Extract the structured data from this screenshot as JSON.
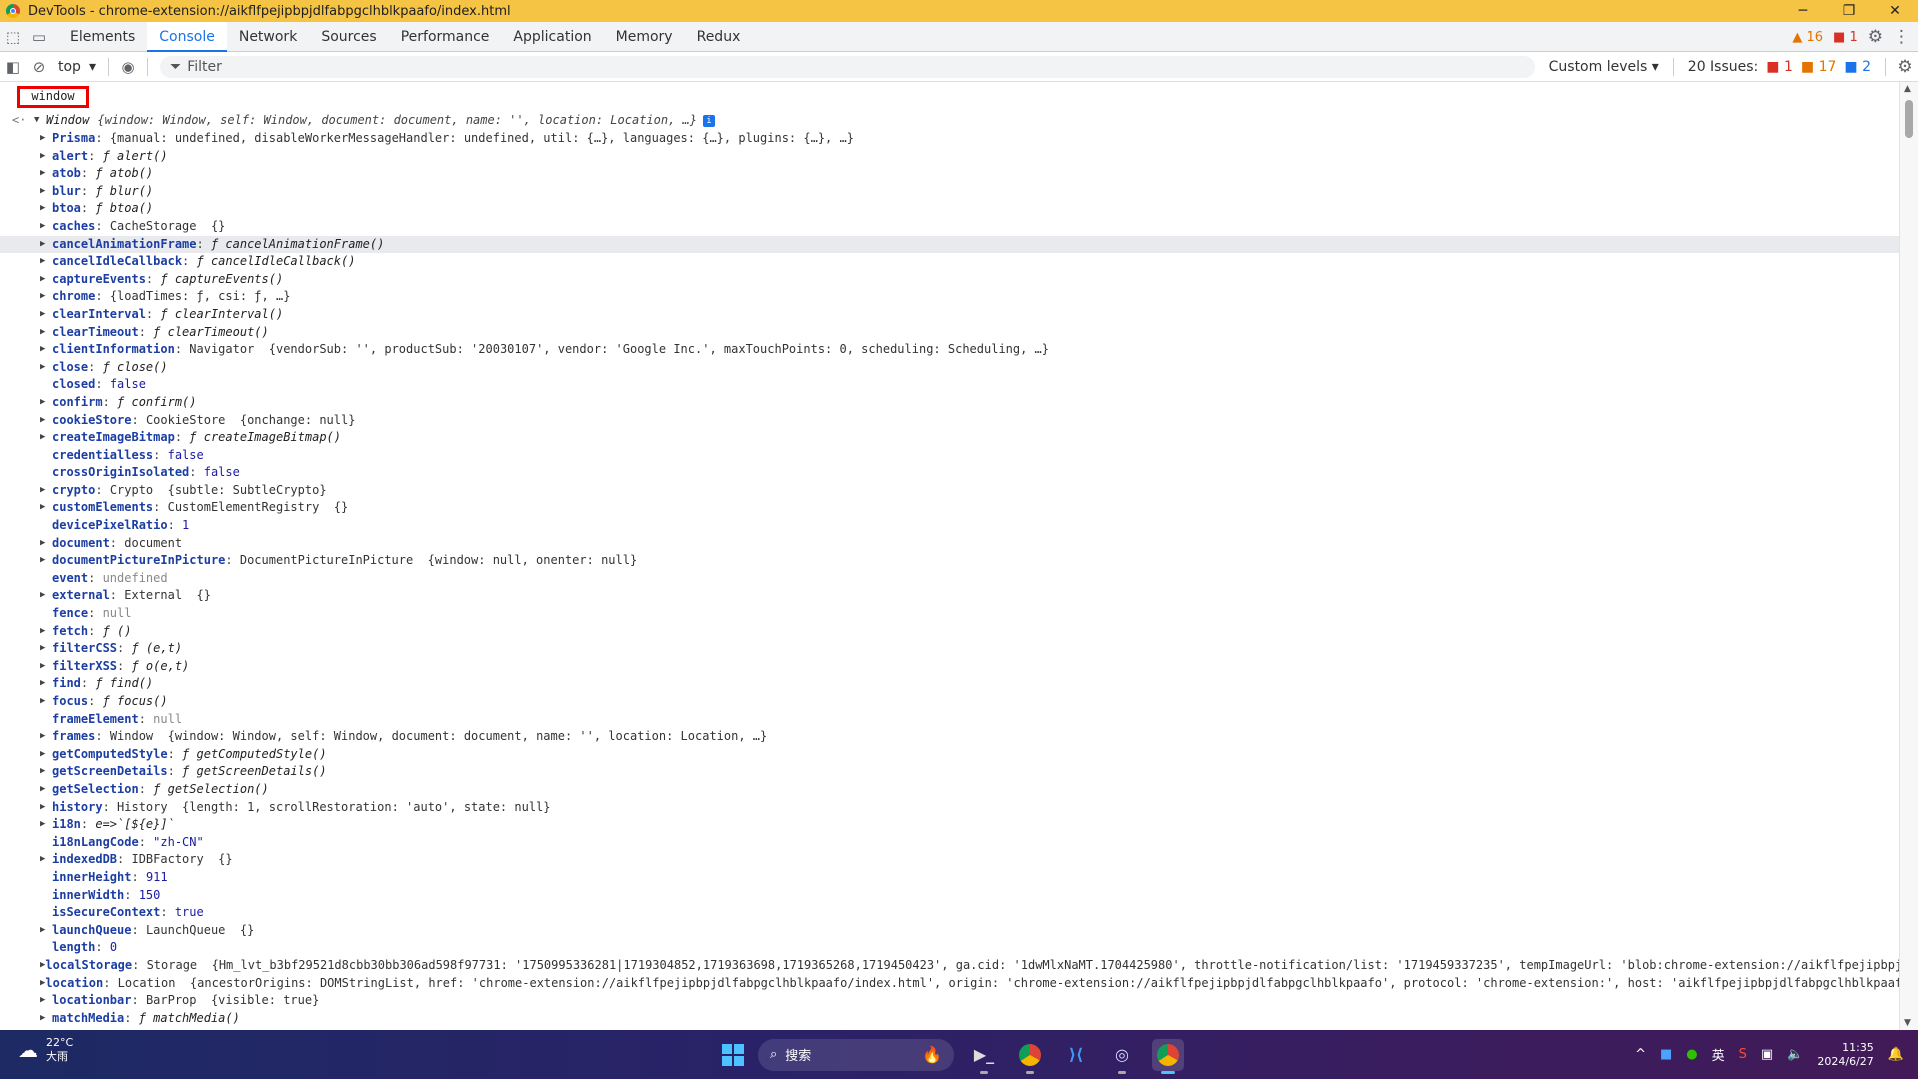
{
  "window": {
    "title": "DevTools - chrome-extension://aikflfpejipbpjdlfabpgclhblkpaafo/index.html",
    "controls": {
      "minimize": "─",
      "restore": "❐",
      "close": "✕"
    }
  },
  "tabs": [
    "Elements",
    "Console",
    "Network",
    "Sources",
    "Performance",
    "Application",
    "Memory",
    "Redux"
  ],
  "active_tab": "Console",
  "tab_status": {
    "warnings": "16",
    "errors": "1"
  },
  "toolbar": {
    "context": "top",
    "filter_placeholder": "Filter",
    "levels": "Custom levels ▾",
    "issues_label": "20 Issues:",
    "issues_errors": "1",
    "issues_warnings": "17",
    "issues_info": "2"
  },
  "console": {
    "command": "window",
    "result": "Window",
    "result_preview": "{window: Window, self: Window, document: document, name: '', location: Location, …}",
    "properties": [
      {
        "key": "Prisma",
        "expand": true,
        "value": "{manual: undefined, disableWorkerMessageHandler: undefined, util: {…}, languages: {…}, plugins: {…}, …}",
        "kind": "obj"
      },
      {
        "key": "alert",
        "expand": true,
        "value": "ƒ alert()",
        "kind": "fn"
      },
      {
        "key": "atob",
        "expand": true,
        "value": "ƒ atob()",
        "kind": "fn"
      },
      {
        "key": "blur",
        "expand": true,
        "value": "ƒ blur()",
        "kind": "fn"
      },
      {
        "key": "btoa",
        "expand": true,
        "value": "ƒ btoa()",
        "kind": "fn"
      },
      {
        "key": "caches",
        "expand": true,
        "value": "CacheStorage  {}",
        "kind": "obj"
      },
      {
        "key": "cancelAnimationFrame",
        "expand": true,
        "value": "ƒ cancelAnimationFrame()",
        "kind": "fn",
        "highlight": true
      },
      {
        "key": "cancelIdleCallback",
        "expand": true,
        "value": "ƒ cancelIdleCallback()",
        "kind": "fn"
      },
      {
        "key": "captureEvents",
        "expand": true,
        "value": "ƒ captureEvents()",
        "kind": "fn"
      },
      {
        "key": "chrome",
        "expand": true,
        "value": "{loadTimes: ƒ, csi: ƒ, …}",
        "kind": "obj"
      },
      {
        "key": "clearInterval",
        "expand": true,
        "value": "ƒ clearInterval()",
        "kind": "fn"
      },
      {
        "key": "clearTimeout",
        "expand": true,
        "value": "ƒ clearTimeout()",
        "kind": "fn"
      },
      {
        "key": "clientInformation",
        "expand": true,
        "value": "Navigator  {vendorSub: '', productSub: '20030107', vendor: 'Google Inc.', maxTouchPoints: 0, scheduling: Scheduling, …}",
        "kind": "obj"
      },
      {
        "key": "close",
        "expand": true,
        "value": "ƒ close()",
        "kind": "fn"
      },
      {
        "key": "closed",
        "expand": false,
        "value": "false",
        "kind": "num"
      },
      {
        "key": "confirm",
        "expand": true,
        "value": "ƒ confirm()",
        "kind": "fn"
      },
      {
        "key": "cookieStore",
        "expand": true,
        "value": "CookieStore  {onchange: null}",
        "kind": "obj"
      },
      {
        "key": "createImageBitmap",
        "expand": true,
        "value": "ƒ createImageBitmap()",
        "kind": "fn"
      },
      {
        "key": "credentialless",
        "expand": false,
        "value": "false",
        "kind": "num"
      },
      {
        "key": "crossOriginIsolated",
        "expand": false,
        "value": "false",
        "kind": "num"
      },
      {
        "key": "crypto",
        "expand": true,
        "value": "Crypto  {subtle: SubtleCrypto}",
        "kind": "obj"
      },
      {
        "key": "customElements",
        "expand": true,
        "value": "CustomElementRegistry  {}",
        "kind": "obj"
      },
      {
        "key": "devicePixelRatio",
        "expand": false,
        "value": "1",
        "kind": "num"
      },
      {
        "key": "document",
        "expand": true,
        "value": "document",
        "kind": "obj"
      },
      {
        "key": "documentPictureInPicture",
        "expand": true,
        "value": "DocumentPictureInPicture  {window: null, onenter: null}",
        "kind": "obj"
      },
      {
        "key": "event",
        "expand": false,
        "value": "undefined",
        "kind": "nul"
      },
      {
        "key": "external",
        "expand": true,
        "value": "External  {}",
        "kind": "obj"
      },
      {
        "key": "fence",
        "expand": false,
        "value": "null",
        "kind": "nul"
      },
      {
        "key": "fetch",
        "expand": true,
        "value": "ƒ ()",
        "kind": "fn"
      },
      {
        "key": "filterCSS",
        "expand": true,
        "value": "ƒ (e,t)",
        "kind": "fn"
      },
      {
        "key": "filterXSS",
        "expand": true,
        "value": "ƒ o(e,t)",
        "kind": "fn"
      },
      {
        "key": "find",
        "expand": true,
        "value": "ƒ find()",
        "kind": "fn"
      },
      {
        "key": "focus",
        "expand": true,
        "value": "ƒ focus()",
        "kind": "fn"
      },
      {
        "key": "frameElement",
        "expand": false,
        "value": "null",
        "kind": "nul"
      },
      {
        "key": "frames",
        "expand": true,
        "value": "Window  {window: Window, self: Window, document: document, name: '', location: Location, …}",
        "kind": "obj"
      },
      {
        "key": "getComputedStyle",
        "expand": true,
        "value": "ƒ getComputedStyle()",
        "kind": "fn"
      },
      {
        "key": "getScreenDetails",
        "expand": true,
        "value": "ƒ getScreenDetails()",
        "kind": "fn"
      },
      {
        "key": "getSelection",
        "expand": true,
        "value": "ƒ getSelection()",
        "kind": "fn"
      },
      {
        "key": "history",
        "expand": true,
        "value": "History  {length: 1, scrollRestoration: 'auto', state: null}",
        "kind": "obj"
      },
      {
        "key": "i18n",
        "expand": true,
        "value": "e=>`[${e}]`",
        "kind": "fn"
      },
      {
        "key": "i18nLangCode",
        "expand": false,
        "value": "\"zh-CN\"",
        "kind": "str"
      },
      {
        "key": "indexedDB",
        "expand": true,
        "value": "IDBFactory  {}",
        "kind": "obj"
      },
      {
        "key": "innerHeight",
        "expand": false,
        "value": "911",
        "kind": "num"
      },
      {
        "key": "innerWidth",
        "expand": false,
        "value": "150",
        "kind": "num"
      },
      {
        "key": "isSecureContext",
        "expand": false,
        "value": "true",
        "kind": "num"
      },
      {
        "key": "launchQueue",
        "expand": true,
        "value": "LaunchQueue  {}",
        "kind": "obj"
      },
      {
        "key": "length",
        "expand": false,
        "value": "0",
        "kind": "num"
      },
      {
        "key": "localStorage",
        "expand": true,
        "value": "Storage  {Hm_lvt_b3bf29521d8cbb30bb306ad598f97731: '1750995336281|1719304852,1719363698,1719365268,1719450423', ga.cid: '1dwMlxNaMT.1704425980', throttle-notification/list: '1719459337235', tempImageUrl: 'blob:chrome-extension://aikflfpejipbpj",
        "kind": "obj"
      },
      {
        "key": "location",
        "expand": true,
        "value": "Location  {ancestorOrigins: DOMStringList, href: 'chrome-extension://aikflfpejipbpjdlfabpgclhblkpaafo/index.html', origin: 'chrome-extension://aikflfpejipbpjdlfabpgclhblkpaafo', protocol: 'chrome-extension:', host: 'aikflfpejipbpjdlfabpgclhblkpaafo",
        "kind": "obj"
      },
      {
        "key": "locationbar",
        "expand": true,
        "value": "BarProp  {visible: true}",
        "kind": "obj"
      },
      {
        "key": "matchMedia",
        "expand": true,
        "value": "ƒ matchMedia()",
        "kind": "fn"
      }
    ]
  },
  "taskbar": {
    "temperature": "22°C",
    "weather": "大雨",
    "search_placeholder": "搜索",
    "apps": [
      "terminal",
      "chrome",
      "vscode",
      "gpt",
      "chrome-devtools"
    ],
    "tray_lang": "英",
    "time": "11:35",
    "date": "2024/6/27"
  }
}
